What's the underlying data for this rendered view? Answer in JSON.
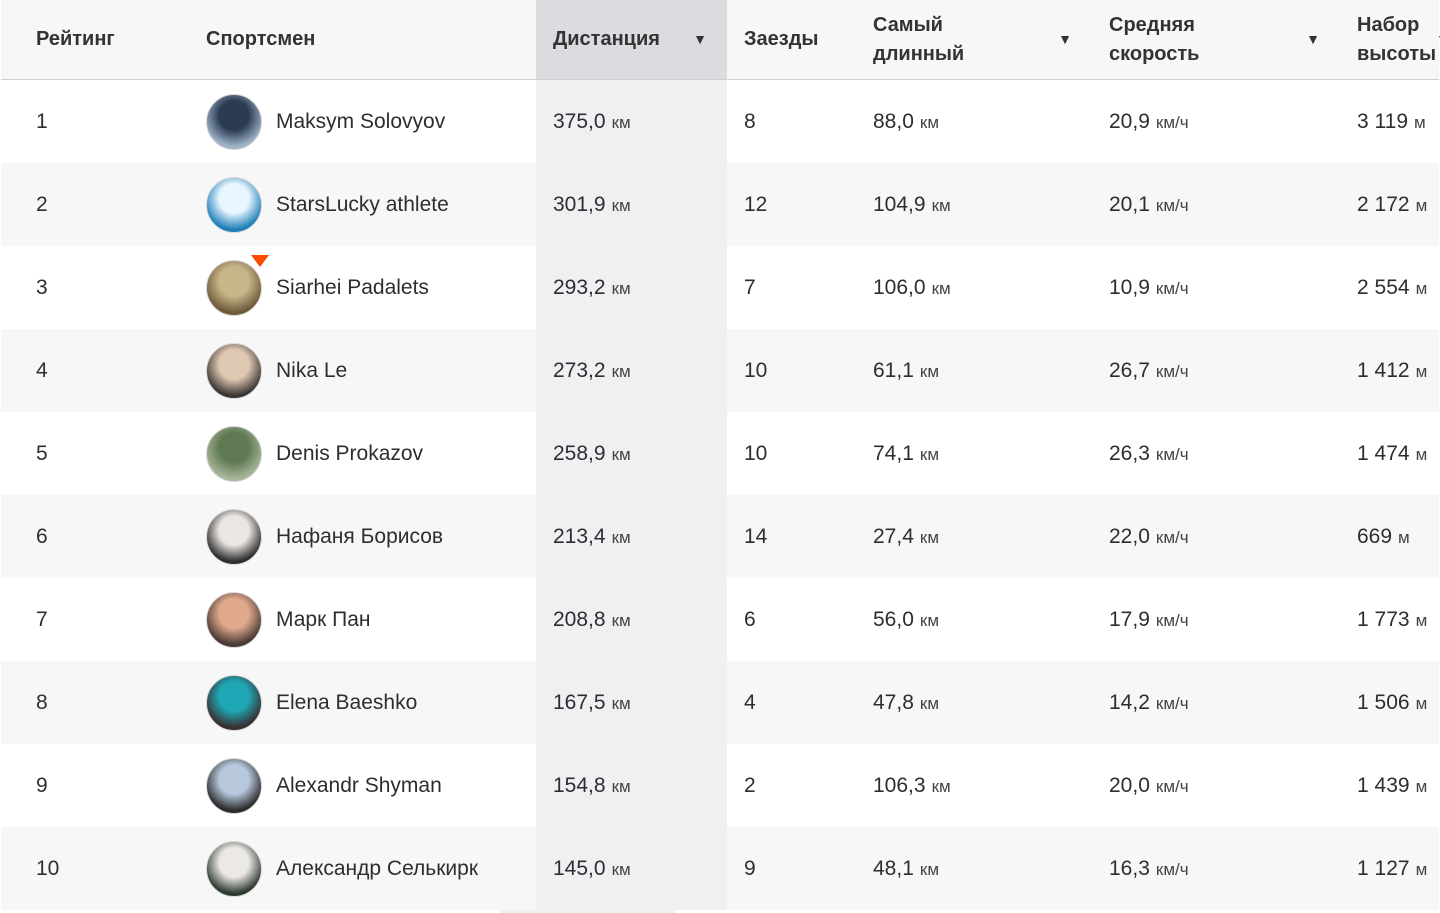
{
  "colors": {
    "accent": "#fc4c02",
    "sorted_column": "#dcdce0"
  },
  "header": {
    "rank": "Рейтинг",
    "athlete": "Спортсмен",
    "distance": "Дистанция",
    "rides": "Заезды",
    "longest": "Самый\nдлинный",
    "avg_speed": "Средняя\nскорость",
    "elevation": "Набор\nвысоты",
    "sort_arrow": "▼",
    "sort_icon": "triangle-down-icon"
  },
  "rows": [
    {
      "rank": "1",
      "name": "Maksym Solovyov",
      "distance": "375,0",
      "distance_unit": "км",
      "rides": "8",
      "longest": "88,0",
      "longest_unit": "км",
      "speed": "20,9",
      "speed_unit": "км/ч",
      "elevation": "3 119",
      "elevation_unit": "м",
      "avatar_colors": [
        "#2a3b52",
        "#9fb3c8"
      ]
    },
    {
      "rank": "2",
      "name": "StarsLucky athlete",
      "distance": "301,9",
      "distance_unit": "км",
      "rides": "12",
      "longest": "104,9",
      "longest_unit": "км",
      "speed": "20,1",
      "speed_unit": "км/ч",
      "elevation": "2 172",
      "elevation_unit": "м",
      "avatar_colors": [
        "#e8f6ff",
        "#1e7fb8"
      ]
    },
    {
      "rank": "3",
      "name": "Siarhei Padalets",
      "distance": "293,2",
      "distance_unit": "км",
      "rides": "7",
      "longest": "106,0",
      "longest_unit": "км",
      "speed": "10,9",
      "speed_unit": "км/ч",
      "elevation": "2 554",
      "elevation_unit": "м",
      "avatar_colors": [
        "#c9b58a",
        "#6d5a3a"
      ]
    },
    {
      "rank": "4",
      "name": "Nika Le",
      "distance": "273,2",
      "distance_unit": "км",
      "rides": "10",
      "longest": "61,1",
      "longest_unit": "км",
      "speed": "26,7",
      "speed_unit": "км/ч",
      "elevation": "1 412",
      "elevation_unit": "м",
      "avatar_colors": [
        "#e0c9b3",
        "#3c3633"
      ]
    },
    {
      "rank": "5",
      "name": "Denis Prokazov",
      "distance": "258,9",
      "distance_unit": "км",
      "rides": "10",
      "longest": "74,1",
      "longest_unit": "км",
      "speed": "26,3",
      "speed_unit": "км/ч",
      "elevation": "1 474",
      "elevation_unit": "м",
      "avatar_colors": [
        "#5f7a52",
        "#a8b59a"
      ]
    },
    {
      "rank": "6",
      "name": "Нафаня Борисов",
      "distance": "213,4",
      "distance_unit": "км",
      "rides": "14",
      "longest": "27,4",
      "longest_unit": "км",
      "speed": "22,0",
      "speed_unit": "км/ч",
      "elevation": "669",
      "elevation_unit": "м",
      "avatar_colors": [
        "#eae6e2",
        "#2e2e2e"
      ]
    },
    {
      "rank": "7",
      "name": "Марк Пан",
      "distance": "208,8",
      "distance_unit": "км",
      "rides": "6",
      "longest": "56,0",
      "longest_unit": "км",
      "speed": "17,9",
      "speed_unit": "км/ч",
      "elevation": "1 773",
      "elevation_unit": "м",
      "avatar_colors": [
        "#e0a98c",
        "#4a3a35"
      ]
    },
    {
      "rank": "8",
      "name": "Elena Baeshko",
      "distance": "167,5",
      "distance_unit": "км",
      "rides": "4",
      "longest": "47,8",
      "longest_unit": "км",
      "speed": "14,2",
      "speed_unit": "км/ч",
      "elevation": "1 506",
      "elevation_unit": "м",
      "avatar_colors": [
        "#1fa7b5",
        "#3a2f30"
      ]
    },
    {
      "rank": "9",
      "name": "Alexandr Shyman",
      "distance": "154,8",
      "distance_unit": "км",
      "rides": "2",
      "longest": "106,3",
      "longest_unit": "км",
      "speed": "20,0",
      "speed_unit": "км/ч",
      "elevation": "1 439",
      "elevation_unit": "м",
      "avatar_colors": [
        "#b7c8dc",
        "#2b2b2b"
      ]
    },
    {
      "rank": "10",
      "name": "Александр Селькирк",
      "distance": "145,0",
      "distance_unit": "км",
      "rides": "9",
      "longest": "48,1",
      "longest_unit": "км",
      "speed": "16,3",
      "speed_unit": "км/ч",
      "elevation": "1 127",
      "elevation_unit": "м",
      "avatar_colors": [
        "#ece8e4",
        "#2d3a30"
      ]
    }
  ]
}
